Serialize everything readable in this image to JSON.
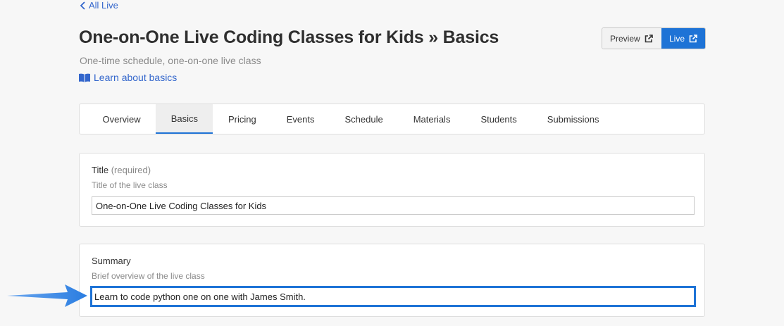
{
  "nav": {
    "back_label": "All Live"
  },
  "header": {
    "title": "One-on-One Live Coding Classes for Kids » Basics",
    "subtitle": "One-time schedule, one-on-one live class",
    "learn_link": "Learn about basics"
  },
  "actions": {
    "preview_label": "Preview",
    "live_label": "Live"
  },
  "tabs": [
    {
      "label": "Overview",
      "active": false
    },
    {
      "label": "Basics",
      "active": true
    },
    {
      "label": "Pricing",
      "active": false
    },
    {
      "label": "Events",
      "active": false
    },
    {
      "label": "Schedule",
      "active": false
    },
    {
      "label": "Materials",
      "active": false
    },
    {
      "label": "Students",
      "active": false
    },
    {
      "label": "Submissions",
      "active": false
    }
  ],
  "fields": {
    "title": {
      "label": "Title",
      "required_note": "(required)",
      "help": "Title of the live class",
      "value": "One-on-One Live Coding Classes for Kids"
    },
    "summary": {
      "label": "Summary",
      "help": "Brief overview of the live class",
      "value": "Learn to code python one on one with James Smith."
    }
  },
  "colors": {
    "accent": "#1e73d6",
    "link": "#3366cc",
    "annotation_arrow": "#2a7de1"
  },
  "icons": {
    "back": "chevron-left-icon",
    "learn": "book-icon",
    "external": "external-link-icon",
    "annotation": "arrow-right-icon"
  }
}
